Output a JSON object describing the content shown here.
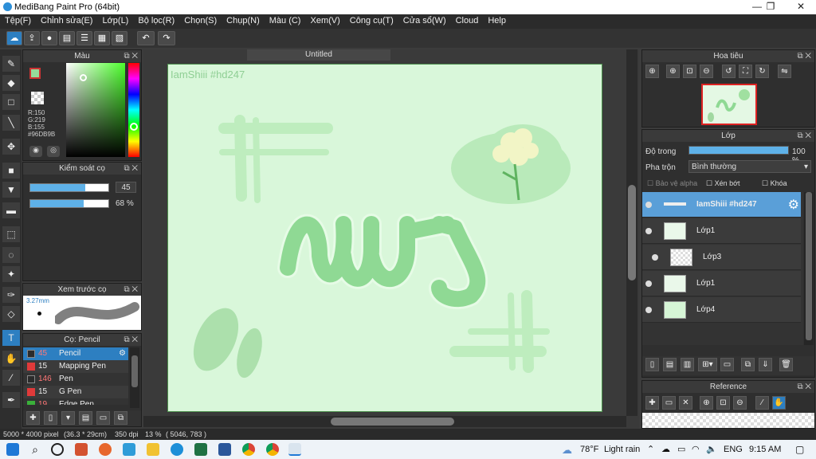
{
  "window": {
    "title": "MediBang Paint Pro (64bit)"
  },
  "menu": [
    "Tệp(F)",
    "Chỉnh sửa(E)",
    "Lớp(L)",
    "Bộ lọc(R)",
    "Chọn(S)",
    "Chụp(N)",
    "Màu (C)",
    "Xem(V)",
    "Công cụ(T)",
    "Cửa sổ(W)",
    "Cloud",
    "Help"
  ],
  "color_panel": {
    "title": "Màu",
    "r": "R:150",
    "g": "G:219",
    "b": "B:155",
    "hex": "#96DB9B",
    "primary": "#96DB9B"
  },
  "brush_control": {
    "title": "Kiểm soát cọ",
    "size_value": "45",
    "size_fill": 0.7,
    "opacity_value": "68 %",
    "opacity_fill": 0.68
  },
  "brush_preview": {
    "title": "Xem trước cọ",
    "size": "3.27mm"
  },
  "brush_list": {
    "title": "Cọ: Pencil",
    "items": [
      {
        "size": "45",
        "name": "Pencil",
        "color": "#2b2b2b",
        "selected": true
      },
      {
        "size": "15",
        "name": "Mapping Pen",
        "color": "#e03a3a",
        "selected": false
      },
      {
        "size": "146",
        "name": "Pen",
        "color": "#2b2b2b",
        "selected": false
      },
      {
        "size": "15",
        "name": "G Pen",
        "color": "#e03a3a",
        "selected": false
      },
      {
        "size": "19",
        "name": "Edge Pen",
        "color": "#3ab03a",
        "selected": false
      }
    ]
  },
  "canvas": {
    "tab": "Untitled",
    "watermark": "IamShiii #hd247",
    "bg": "#d9f7da"
  },
  "navigator": {
    "title": "Hoa tiêu"
  },
  "layer_panel": {
    "title": "Lớp",
    "opacity_label": "Độ trong",
    "opacity_value": "100 %",
    "blend_label": "Pha trộn",
    "blend_value": "Bình thường",
    "protect_alpha": "Bảo vệ alpha",
    "clipping": "Xén bớt",
    "lock": "Khóa",
    "layers": [
      {
        "name": "IamShiii #hd247",
        "selected": true,
        "indent": false
      },
      {
        "name": "Lớp1",
        "selected": false,
        "indent": false
      },
      {
        "name": "Lớp3",
        "selected": false,
        "indent": true
      },
      {
        "name": "Lớp1",
        "selected": false,
        "indent": false
      },
      {
        "name": "Lớp4",
        "selected": false,
        "indent": false
      }
    ]
  },
  "reference": {
    "title": "Reference"
  },
  "status": {
    "size": "5000 * 4000 pixel",
    "cm": "(36.3 * 29cm)",
    "dpi": "350 dpi",
    "zoom": "13 %",
    "coords": "( 5046, 783 )"
  },
  "taskbar": {
    "temp": "78°F",
    "weather": "Light rain",
    "lang": "ENG",
    "time": "9:15 AM"
  }
}
